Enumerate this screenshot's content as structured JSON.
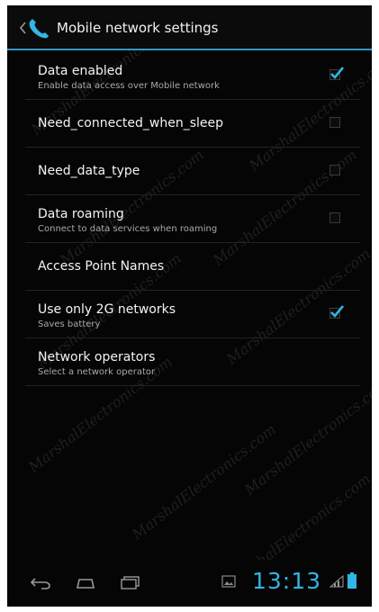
{
  "action_bar": {
    "title": "Mobile network settings",
    "up_icon": "chevron-left-icon",
    "app_icon": "phone-handset-icon",
    "accent_color": "#33b5e5"
  },
  "preferences": [
    {
      "title": "Data enabled",
      "summary": "Enable data access over Mobile network",
      "checkbox": true,
      "checked": true
    },
    {
      "title": "Need_connected_when_sleep",
      "summary": "",
      "checkbox": true,
      "checked": false
    },
    {
      "title": "Need_data_type",
      "summary": "",
      "checkbox": true,
      "checked": false
    },
    {
      "title": "Data roaming",
      "summary": "Connect to data services when roaming",
      "checkbox": true,
      "checked": false
    },
    {
      "title": "Access Point Names",
      "summary": "",
      "checkbox": false,
      "checked": false
    },
    {
      "title": "Use only 2G networks",
      "summary": "Saves battery",
      "checkbox": true,
      "checked": true
    },
    {
      "title": "Network operators",
      "summary": "Select a network operator",
      "checkbox": false,
      "checked": false
    }
  ],
  "watermark": {
    "text": "MarshalElectronics.com"
  },
  "nav_bar": {
    "back_icon": "back-icon",
    "home_icon": "home-icon",
    "recent_apps_icon": "recent-apps-icon"
  },
  "status": {
    "clock": "13:13",
    "gallery_icon": "gallery-icon",
    "signal_icon": "signal-icon",
    "battery_icon": "battery-icon"
  }
}
